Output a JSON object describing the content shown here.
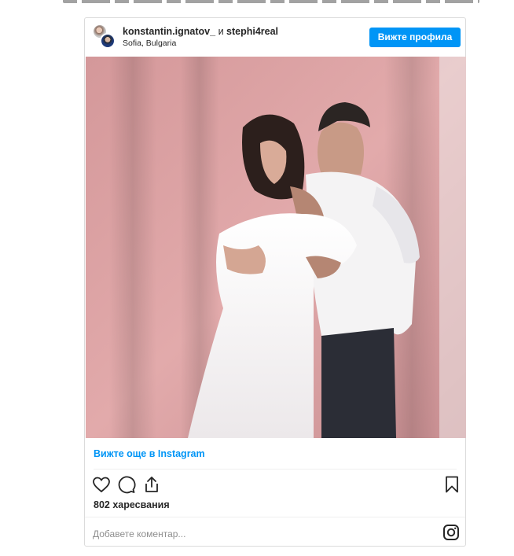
{
  "header": {
    "user1": "konstantin.ignatov_",
    "conjunction": "и",
    "user2": "stephi4real",
    "location": "Sofia, Bulgaria",
    "profile_button": "Вижте профила"
  },
  "post": {
    "view_more_link": "Вижте още в Instagram",
    "likes": "802 харесвания",
    "comment_placeholder": "Добавете коментар..."
  },
  "icons": {
    "like": "heart-icon",
    "comment": "comment-icon",
    "share": "share-icon",
    "save": "bookmark-icon",
    "brand": "instagram-icon"
  },
  "colors": {
    "accent": "#0095f6",
    "text": "#262626",
    "muted": "#8e8e8e",
    "backdrop": "#d99ea0"
  }
}
